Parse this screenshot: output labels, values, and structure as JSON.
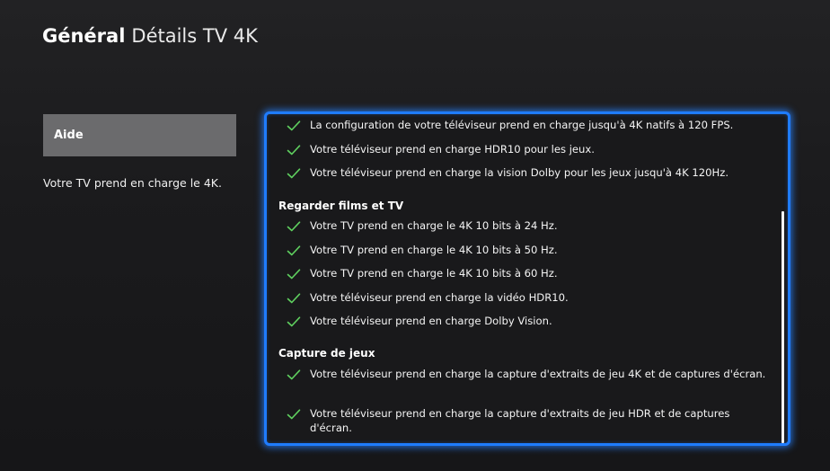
{
  "header": {
    "section": "Général",
    "page": "Détails TV 4K"
  },
  "sidebar": {
    "help_label": "Aide",
    "description": "Votre TV prend en charge le 4K."
  },
  "panel": {
    "accent_color": "#1f7cff",
    "check_color": "#5fd05f",
    "check_icon": "checkmark-icon",
    "gaming_items": [
      "La configuration de votre téléviseur prend en charge jusqu'à 4K natifs à 120 FPS.",
      "Votre téléviseur prend en charge HDR10 pour les jeux.",
      "Votre téléviseur prend en charge la vision Dolby pour les jeux jusqu'à 4K 120Hz."
    ],
    "movies_heading": "Regarder films et TV",
    "movies_items": [
      "Votre TV prend en charge le 4K 10 bits à 24 Hz.",
      "Votre TV prend en charge le 4K 10 bits à 50 Hz.",
      "Votre TV prend en charge le 4K 10 bits à 60 Hz.",
      "Votre téléviseur prend en charge la vidéo HDR10.",
      "Votre téléviseur prend en charge Dolby Vision."
    ],
    "capture_heading": "Capture de jeux",
    "capture_items": [
      "Votre téléviseur prend en charge la capture d'extraits de jeu 4K et de captures d'écran.",
      "Votre téléviseur prend en charge la capture d'extraits de jeu HDR et de captures d'écran."
    ]
  }
}
